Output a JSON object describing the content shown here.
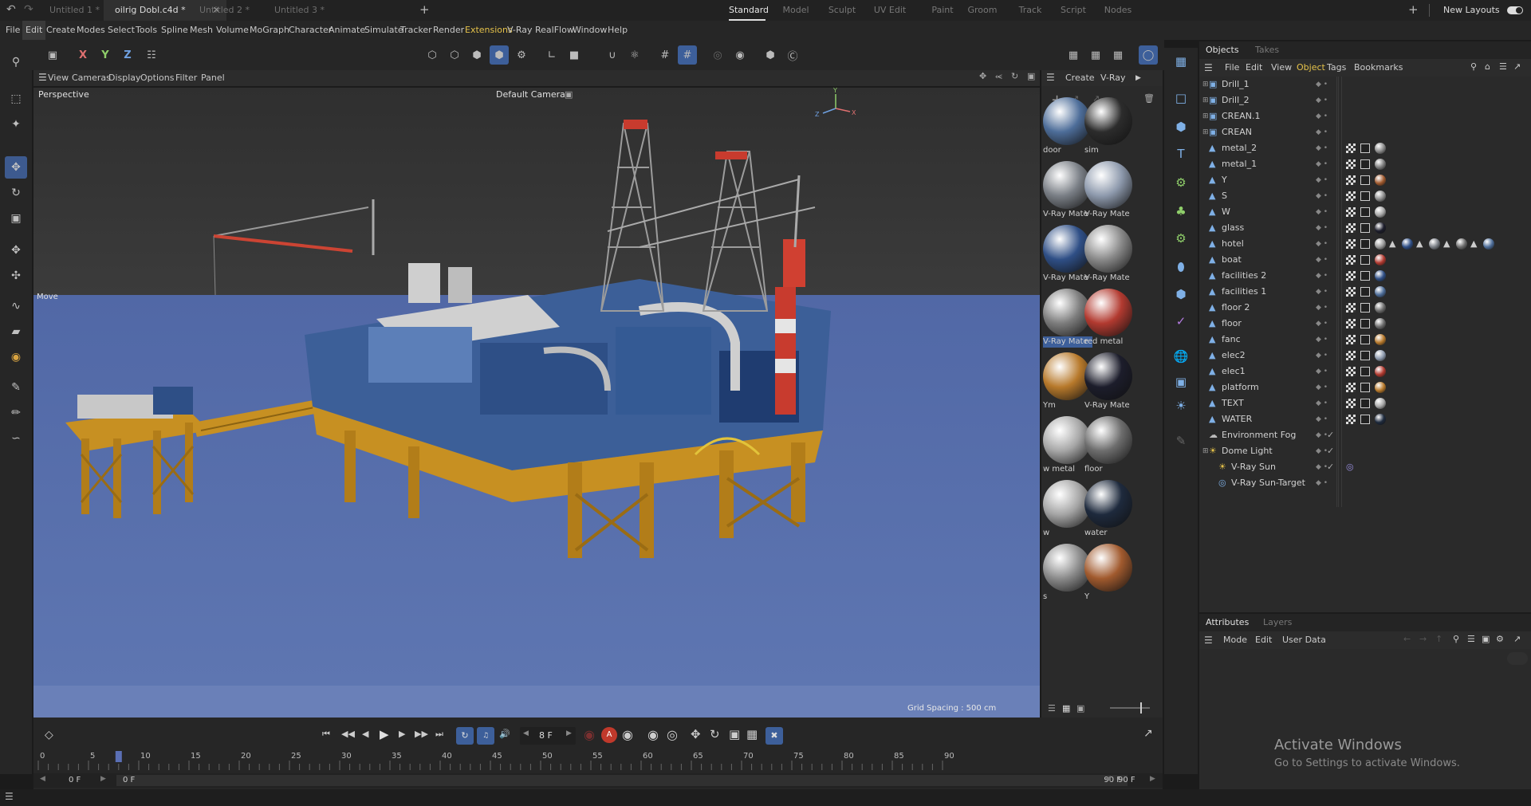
{
  "tabs": [
    {
      "label": "Untitled 1 *",
      "active": false
    },
    {
      "label": "oilrig Dobl.c4d *",
      "active": true
    },
    {
      "label": "Untitled 2 *",
      "active": false
    },
    {
      "label": "Untitled 3 *",
      "active": false
    }
  ],
  "layouts": [
    {
      "label": "Standard",
      "active": true
    },
    {
      "label": "Model"
    },
    {
      "label": "Sculpt"
    },
    {
      "label": "UV Edit"
    },
    {
      "label": "Paint"
    },
    {
      "label": "Groom"
    },
    {
      "label": "Track"
    },
    {
      "label": "Script"
    },
    {
      "label": "Nodes"
    }
  ],
  "new_layouts": "New Layouts",
  "menu": [
    "File",
    "Edit",
    "Create",
    "Modes",
    "Select",
    "Tools",
    "Spline",
    "Mesh",
    "Volume",
    "MoGraph",
    "Character",
    "Animate",
    "Simulate",
    "Tracker",
    "Render",
    "Extensions",
    "V-Ray",
    "RealFlow",
    "Window",
    "Help"
  ],
  "axis_buttons": [
    "X",
    "Y",
    "Z"
  ],
  "viewport": {
    "menu": [
      "View",
      "Cameras",
      "Display",
      "Options",
      "Filter",
      "Panel"
    ],
    "name": "Perspective",
    "camera": "Default Camera",
    "move_label": "Move",
    "grid_spacing": "Grid Spacing : 500 cm"
  },
  "materials": {
    "menu": [
      "Create",
      "V-Ray"
    ],
    "items": [
      {
        "name": "door",
        "color": "#4d6d99"
      },
      {
        "name": "sim",
        "color": "#2c2c2c"
      },
      {
        "name": "V-Ray Mate",
        "color": "#7a7f86"
      },
      {
        "name": "V-Ray Mate",
        "color": "#8e9aad"
      },
      {
        "name": "V-Ray Mate",
        "color": "#2f4f86"
      },
      {
        "name": "V-Ray Mate",
        "color": "#8a8a8a"
      },
      {
        "name": "V-Ray Mate",
        "color": "#7d7d7d",
        "selected": true
      },
      {
        "name": "red metal",
        "color": "#b23a30"
      },
      {
        "name": "Ym",
        "color": "#b7792b"
      },
      {
        "name": "V-Ray Mate",
        "color": "#1c1d2b"
      },
      {
        "name": "w metal",
        "color": "#a7a7a7"
      },
      {
        "name": "floor",
        "color": "#6d6d6d"
      },
      {
        "name": "w",
        "color": "#a5a5a5"
      },
      {
        "name": "water",
        "color": "#1e2a3d"
      },
      {
        "name": "s",
        "color": "#8c8c8c"
      },
      {
        "name": "Y",
        "color": "#a15a2e"
      }
    ]
  },
  "objects_panel": {
    "tabs": [
      "Objects",
      "Takes"
    ],
    "menu": [
      "File",
      "Edit",
      "View",
      "Object",
      "Tags",
      "Bookmarks"
    ],
    "items": [
      {
        "name": "Drill_1",
        "kind": "group",
        "tags": []
      },
      {
        "name": "Drill_2",
        "kind": "group",
        "tags": []
      },
      {
        "name": "CREAN.1",
        "kind": "group",
        "tags": []
      },
      {
        "name": "CREAN",
        "kind": "group",
        "tags": []
      },
      {
        "name": "metal_2",
        "kind": "mesh",
        "tags": [
          "#8a8a8a"
        ]
      },
      {
        "name": "metal_1",
        "kind": "mesh",
        "tags": [
          "#7d7d7d"
        ]
      },
      {
        "name": "Y",
        "kind": "mesh",
        "tags": [
          "#a15a2e"
        ]
      },
      {
        "name": "S",
        "kind": "mesh",
        "tags": [
          "#8c8c8c"
        ]
      },
      {
        "name": "W",
        "kind": "mesh",
        "tags": [
          "#a5a5a5"
        ]
      },
      {
        "name": "glass",
        "kind": "mesh",
        "tags": [
          "#1c1d2b"
        ]
      },
      {
        "name": "hotel",
        "kind": "mesh",
        "tags": [
          "#9a9a9a",
          "#2f4f86",
          "#7a7f86",
          "#6d6d6d",
          "#4d6d99"
        ]
      },
      {
        "name": "boat",
        "kind": "mesh",
        "tags": [
          "#b23a30"
        ]
      },
      {
        "name": "facilities 2",
        "kind": "mesh",
        "tags": [
          "#2f4f86"
        ]
      },
      {
        "name": "facilities 1",
        "kind": "mesh",
        "tags": [
          "#4d6d99"
        ]
      },
      {
        "name": "floor 2",
        "kind": "mesh",
        "tags": [
          "#6d6d6d"
        ]
      },
      {
        "name": "floor",
        "kind": "mesh",
        "tags": [
          "#6d6d6d"
        ]
      },
      {
        "name": "fanc",
        "kind": "mesh",
        "tags": [
          "#b7792b"
        ]
      },
      {
        "name": "elec2",
        "kind": "mesh",
        "tags": [
          "#8e9aad"
        ]
      },
      {
        "name": "elec1",
        "kind": "mesh",
        "tags": [
          "#b23a30"
        ]
      },
      {
        "name": "platform",
        "kind": "mesh",
        "tags": [
          "#b7792b"
        ]
      },
      {
        "name": "TEXT",
        "kind": "mesh",
        "tags": [
          "#a7a7a7"
        ]
      },
      {
        "name": "WATER",
        "kind": "mesh",
        "tags": [
          "#1e2a3d"
        ]
      },
      {
        "name": "Environment Fog",
        "kind": "fog",
        "tags": []
      },
      {
        "name": "Dome Light",
        "kind": "light",
        "tags": []
      },
      {
        "name": "V-Ray Sun",
        "kind": "sun",
        "tags": []
      },
      {
        "name": "V-Ray Sun-Target",
        "kind": "target",
        "tags": []
      }
    ]
  },
  "attributes_panel": {
    "tabs": [
      "Attributes",
      "Layers"
    ],
    "menu": [
      "Mode",
      "Edit",
      "User Data"
    ]
  },
  "timeline": {
    "current_frame": "8 F",
    "ticks": [
      "0",
      "5",
      "10",
      "15",
      "20",
      "25",
      "30",
      "35",
      "40",
      "45",
      "50",
      "55",
      "60",
      "65",
      "70",
      "75",
      "80",
      "85",
      "90"
    ],
    "start_field": "0 F",
    "range_start": "0 F",
    "range_end": "90 F",
    "end_field": "90 F",
    "playhead_frame": 8,
    "max_frame": 90
  },
  "watermark": {
    "title": "Activate Windows",
    "subtitle": "Go to Settings to activate Windows."
  }
}
